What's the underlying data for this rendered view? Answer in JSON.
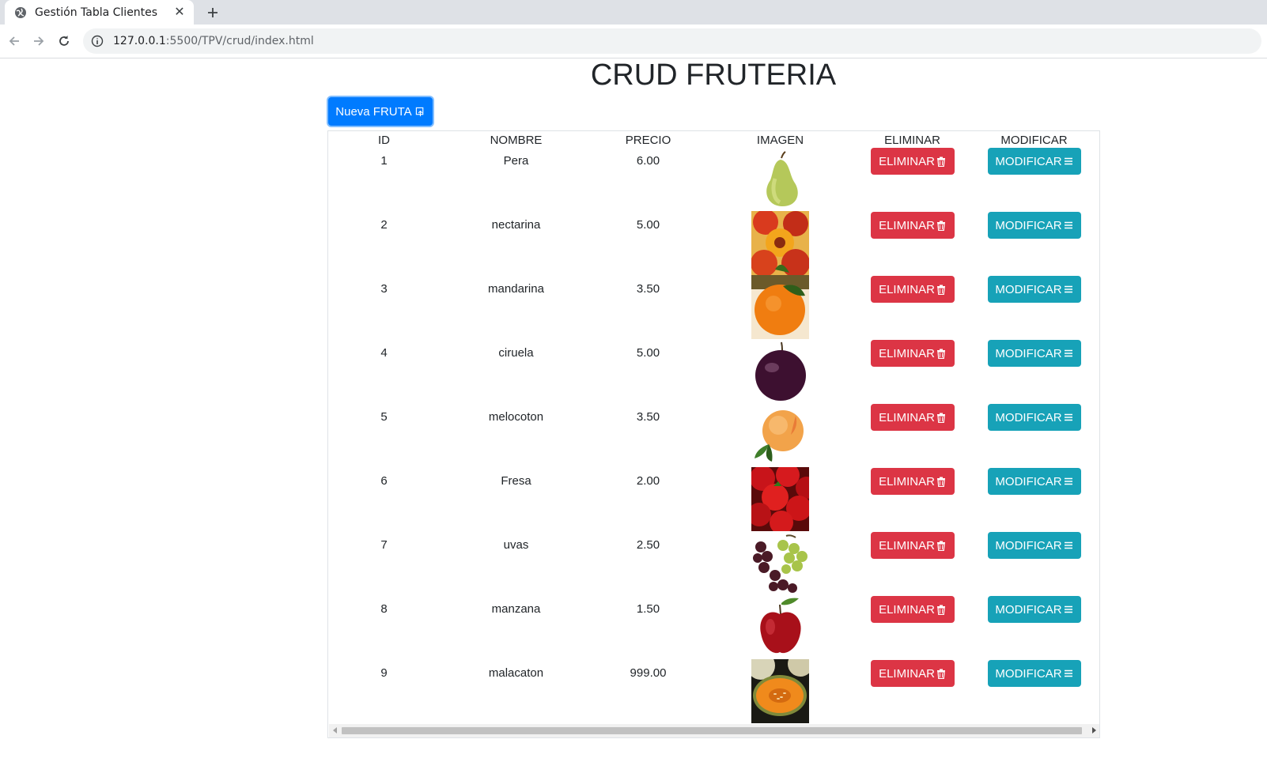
{
  "browser": {
    "tab_title": "Gestión Tabla Clientes",
    "url_host": "127.0.0.1",
    "url_rest": ":5500/TPV/crud/index.html"
  },
  "page": {
    "title": "CRUD FRUTERIA",
    "new_button": "Nueva FRUTA"
  },
  "table": {
    "headers": [
      "ID",
      "NOMBRE",
      "PRECIO",
      "IMAGEN",
      "ELIMINAR",
      "MODIFICAR"
    ],
    "delete_label": "ELIMINAR",
    "modify_label": "MODIFICAR",
    "rows": [
      {
        "id": "1",
        "nombre": "Pera",
        "precio": "6.00",
        "fruit": "pear"
      },
      {
        "id": "2",
        "nombre": "nectarina",
        "precio": "5.00",
        "fruit": "nectarine"
      },
      {
        "id": "3",
        "nombre": "mandarina",
        "precio": "3.50",
        "fruit": "mandarin"
      },
      {
        "id": "4",
        "nombre": "ciruela",
        "precio": "5.00",
        "fruit": "plum"
      },
      {
        "id": "5",
        "nombre": "melocoton",
        "precio": "3.50",
        "fruit": "peach"
      },
      {
        "id": "6",
        "nombre": "Fresa",
        "precio": "2.00",
        "fruit": "strawberry"
      },
      {
        "id": "7",
        "nombre": "uvas",
        "precio": "2.50",
        "fruit": "grapes"
      },
      {
        "id": "8",
        "nombre": "manzana",
        "precio": "1.50",
        "fruit": "apple"
      },
      {
        "id": "9",
        "nombre": "malacaton",
        "precio": "999.00",
        "fruit": "cantaloupe"
      }
    ]
  },
  "colors": {
    "primary": "#007bff",
    "danger": "#dc3545",
    "info": "#17a2b8"
  }
}
